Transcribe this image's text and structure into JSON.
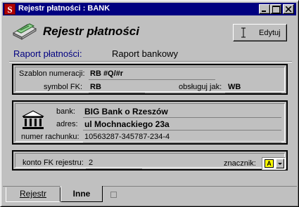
{
  "window": {
    "title": "Rejestr płatności : BANK",
    "app_icon_letter": "S"
  },
  "header": {
    "title": "Rejestr płatności",
    "edit_button": "Edytuj"
  },
  "report": {
    "label": "Raport płatności:",
    "value": "Raport bankowy"
  },
  "numbering": {
    "template_label": "Szablon numeracji:",
    "template_value": "RB #Q/#r",
    "fk_symbol_label": "symbol FK:",
    "fk_symbol_value": "RB",
    "handle_as_label": "obsługuj jak:",
    "handle_as_value": "WB"
  },
  "bank": {
    "bank_label": "bank:",
    "bank_value": "BIG Bank o Rzeszów",
    "address_label": "adres:",
    "address_value": "ul Mochnackiego 23a",
    "account_label": "numer rachunku:",
    "account_value": "10563287-345787-234-4"
  },
  "fk_account": {
    "label": "konto FK rejestru:",
    "value": "2",
    "marker_label": "znacznik:",
    "marker_value": "A"
  },
  "tabs": [
    {
      "label": "Rejestr"
    },
    {
      "label": "Inne"
    }
  ],
  "colors": {
    "titlebar": "#000080",
    "report_label": "#000080",
    "marker_badge": "#ffff00"
  }
}
